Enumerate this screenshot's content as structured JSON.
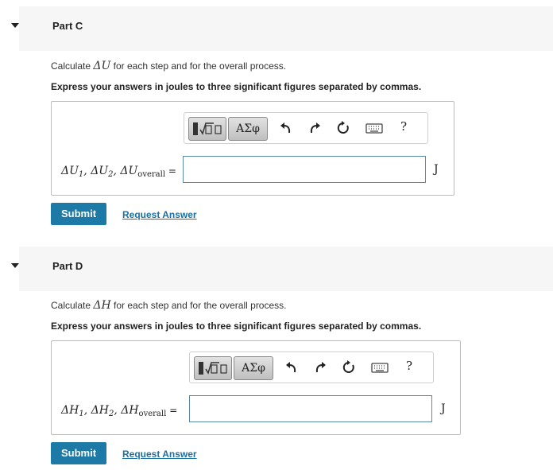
{
  "parts": [
    {
      "title": "Part C",
      "prompt_pre": "Calculate ",
      "prompt_math": "ΔU",
      "prompt_post": " for each step and for the overall process.",
      "instruction": "Express your answers in joules to three significant figures separated by commas.",
      "var_main": "ΔU",
      "var_1": "1",
      "var_mid": ", ΔU",
      "var_2": "2",
      "var_mid2": ", ΔU",
      "var_sub": "overall",
      "var_eq": " =",
      "input_value": "",
      "unit": "J",
      "symbols_label": "ΑΣφ",
      "help_label": "?",
      "submit_label": "Submit",
      "request_label": "Request Answer"
    },
    {
      "title": "Part D",
      "prompt_pre": "Calculate ",
      "prompt_math": "ΔH",
      "prompt_post": " for each step and for the overall process.",
      "instruction": "Express your answers in joules to three significant figures separated by commas.",
      "var_main": "ΔH",
      "var_1": "1",
      "var_mid": ", ΔH",
      "var_2": "2",
      "var_mid2": ", ΔH",
      "var_sub": "overall",
      "var_eq": " =",
      "input_value": "",
      "unit": "J",
      "symbols_label": "ΑΣφ",
      "help_label": "?",
      "submit_label": "Submit",
      "request_label": "Request Answer"
    }
  ],
  "icons": [
    "collapse-caret-icon",
    "templates-icon",
    "undo-icon",
    "redo-icon",
    "reset-icon",
    "keyboard-icon",
    "help-icon"
  ]
}
